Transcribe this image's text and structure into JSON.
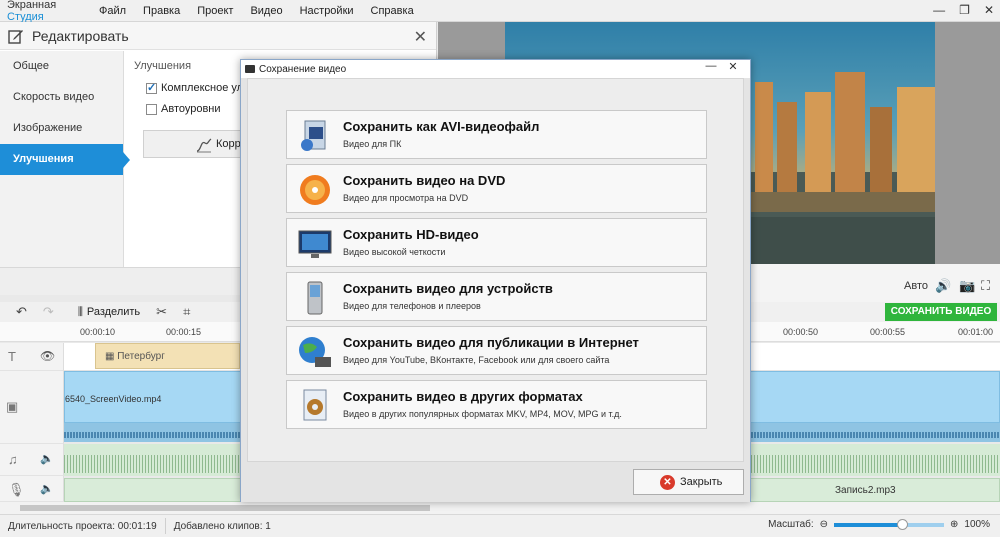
{
  "app": {
    "title_main": "Экранная ",
    "title_accent": "Студия",
    "accent_color": "#1a8fd6"
  },
  "menu": [
    "Файл",
    "Правка",
    "Проект",
    "Видео",
    "Настройки",
    "Справка"
  ],
  "edit_panel": {
    "title": "Редактировать",
    "nav": [
      "Общее",
      "Скорость видео",
      "Изображение",
      "Улучшения"
    ],
    "active_nav": "Улучшения",
    "section": "Улучшения",
    "checkbox1": "Комплексное улу",
    "checkbox2": "Автоуровни",
    "correct_button": "Корр"
  },
  "preview": {
    "auto_label": "Авто"
  },
  "toolbar": {
    "split_label": "Разделить",
    "save_video": "СОХРАНИТЬ ВИДЕО",
    "save_color": "#2fb53c"
  },
  "ruler": [
    "00:00:10",
    "00:00:15",
    "00:00:50",
    "00:00:55",
    "00:01:00"
  ],
  "tracks": {
    "title_clip": "Петербург",
    "video_clip": "6540_ScreenVideo.mp4",
    "audio2_clip": "Запись2.mp3"
  },
  "status": {
    "duration": "Длительность проекта:  00:01:19",
    "clips": "Добавлено клипов: 1",
    "zoom_label": "Масштаб:",
    "zoom_value": "100%",
    "zoom_level": 0.62
  },
  "dialog": {
    "title": "Сохранение видео",
    "options": [
      {
        "title": "Сохранить как AVI-видеофайл",
        "subtitle": "Видео для ПК",
        "icon": "avi-file-icon"
      },
      {
        "title": "Сохранить видео на DVD",
        "subtitle": "Видео для просмотра на DVD",
        "icon": "dvd-disc-icon"
      },
      {
        "title": "Сохранить HD-видео",
        "subtitle": "Видео высокой четкости",
        "icon": "hd-monitor-icon"
      },
      {
        "title": "Сохранить видео для устройств",
        "subtitle": "Видео для телефонов и плееров",
        "icon": "phone-device-icon"
      },
      {
        "title": "Сохранить видео для публикации в Интернет",
        "subtitle": "Видео для YouTube, ВКонтакте, Facebook или для своего сайта",
        "icon": "globe-internet-icon"
      },
      {
        "title": "Сохранить видео в других форматах",
        "subtitle": "Видео в других популярных форматах MKV, MP4, MOV, MPG и т.д.",
        "icon": "film-file-icon"
      }
    ],
    "close_label": "Закрыть"
  }
}
